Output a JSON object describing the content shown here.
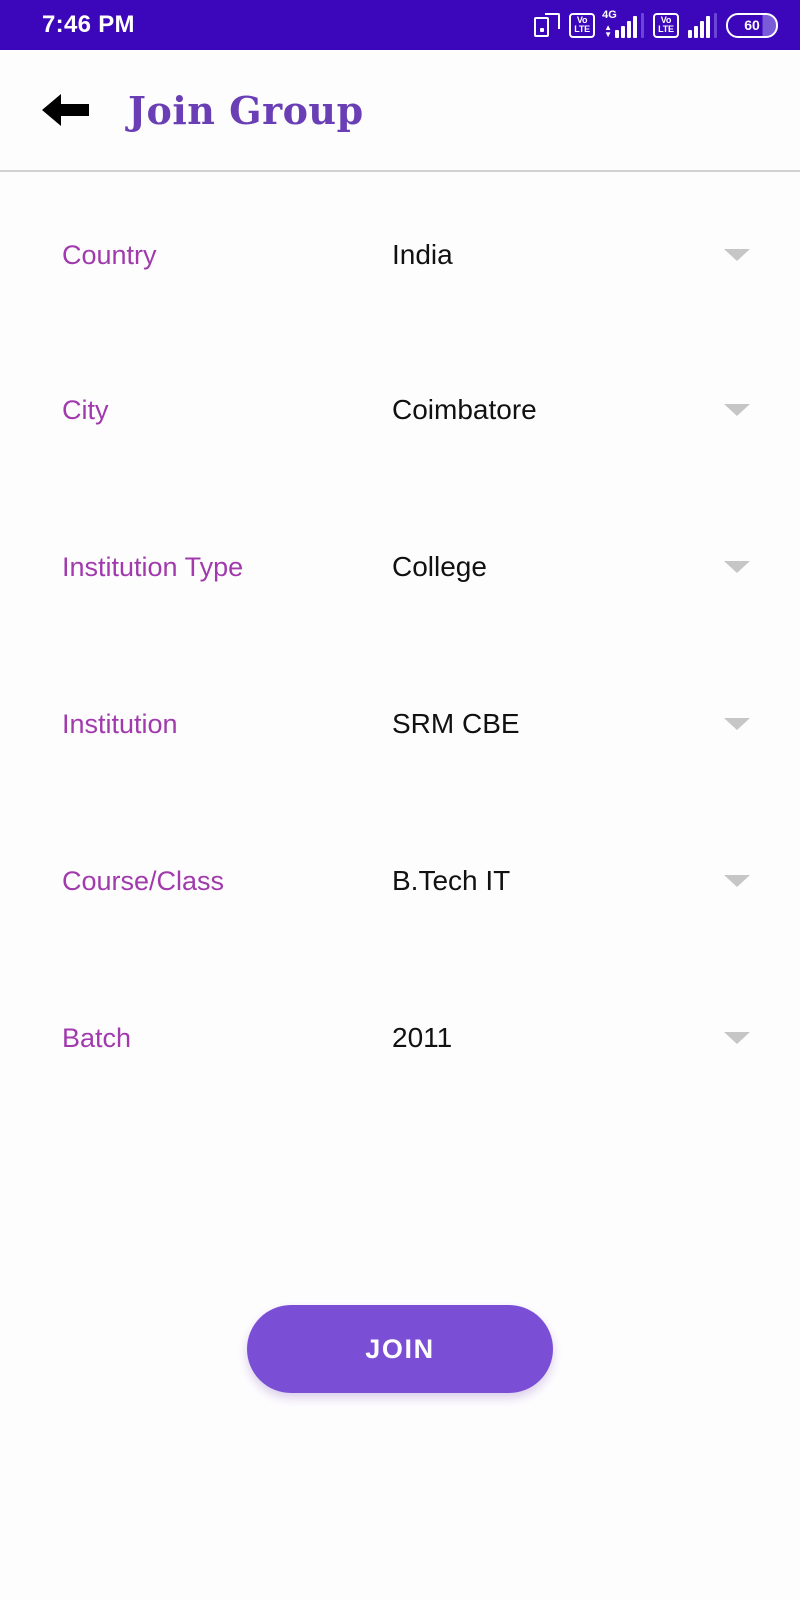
{
  "status_bar": {
    "time": "7:46 PM",
    "background_color": "#3C06BA",
    "icons": [
      {
        "name": "screen-cast-icon",
        "label": ""
      },
      {
        "name": "volte-sim1-icon",
        "label": "VoLTE"
      },
      {
        "name": "signal-sim1-icon",
        "label": "4G"
      },
      {
        "name": "volte-sim2-icon",
        "label": "VoLTE"
      },
      {
        "name": "signal-sim2-icon",
        "label": ""
      }
    ],
    "volte_top": "Vo",
    "volte_bottom": "LTE",
    "network_type": "4G",
    "battery_level": "60"
  },
  "app_bar": {
    "back_icon": "arrow-left-icon",
    "title": "Join Group",
    "title_color": "#6A3FB5"
  },
  "form": {
    "label_color": "#A03AAD",
    "value_color": "#111111",
    "caret_color": "#C6C6C6",
    "fields": [
      {
        "label": "Country",
        "value": "India",
        "icon": "chevron-down-icon"
      },
      {
        "label": "City",
        "value": "Coimbatore",
        "icon": "chevron-down-icon"
      },
      {
        "label": "Institution Type",
        "value": "College",
        "icon": "chevron-down-icon"
      },
      {
        "label": "Institution",
        "value": "SRM CBE",
        "icon": "chevron-down-icon"
      },
      {
        "label": "Course/Class",
        "value": "B.Tech IT",
        "icon": "chevron-down-icon"
      },
      {
        "label": "Batch",
        "value": "2011",
        "icon": "chevron-down-icon"
      }
    ]
  },
  "actions": {
    "join_label": "JOIN",
    "join_color": "#7B4FD5"
  }
}
